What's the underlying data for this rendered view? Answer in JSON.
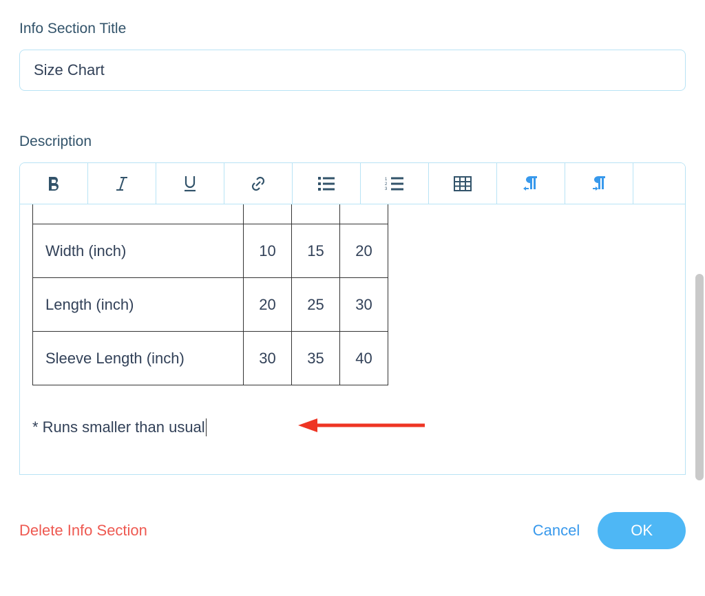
{
  "title_field": {
    "label": "Info Section Title",
    "value": "Size Chart"
  },
  "description": {
    "label": "Description"
  },
  "toolbar": {
    "bold": "bold-icon",
    "italic": "italic-icon",
    "underline": "underline-icon",
    "link": "link-icon",
    "ul": "bullet-list-icon",
    "ol": "numbered-list-icon",
    "table": "table-icon",
    "ltr": "ltr-icon",
    "rtl": "rtl-icon"
  },
  "table": {
    "rows": [
      {
        "label": "Width (inch)",
        "c1": "10",
        "c2": "15",
        "c3": "20"
      },
      {
        "label": "Length (inch)",
        "c1": "20",
        "c2": "25",
        "c3": "30"
      },
      {
        "label": "Sleeve Length (inch)",
        "c1": "30",
        "c2": "35",
        "c3": "40"
      }
    ]
  },
  "note": "* Runs smaller than usual",
  "footer": {
    "delete": "Delete Info Section",
    "cancel": "Cancel",
    "ok": "OK"
  }
}
